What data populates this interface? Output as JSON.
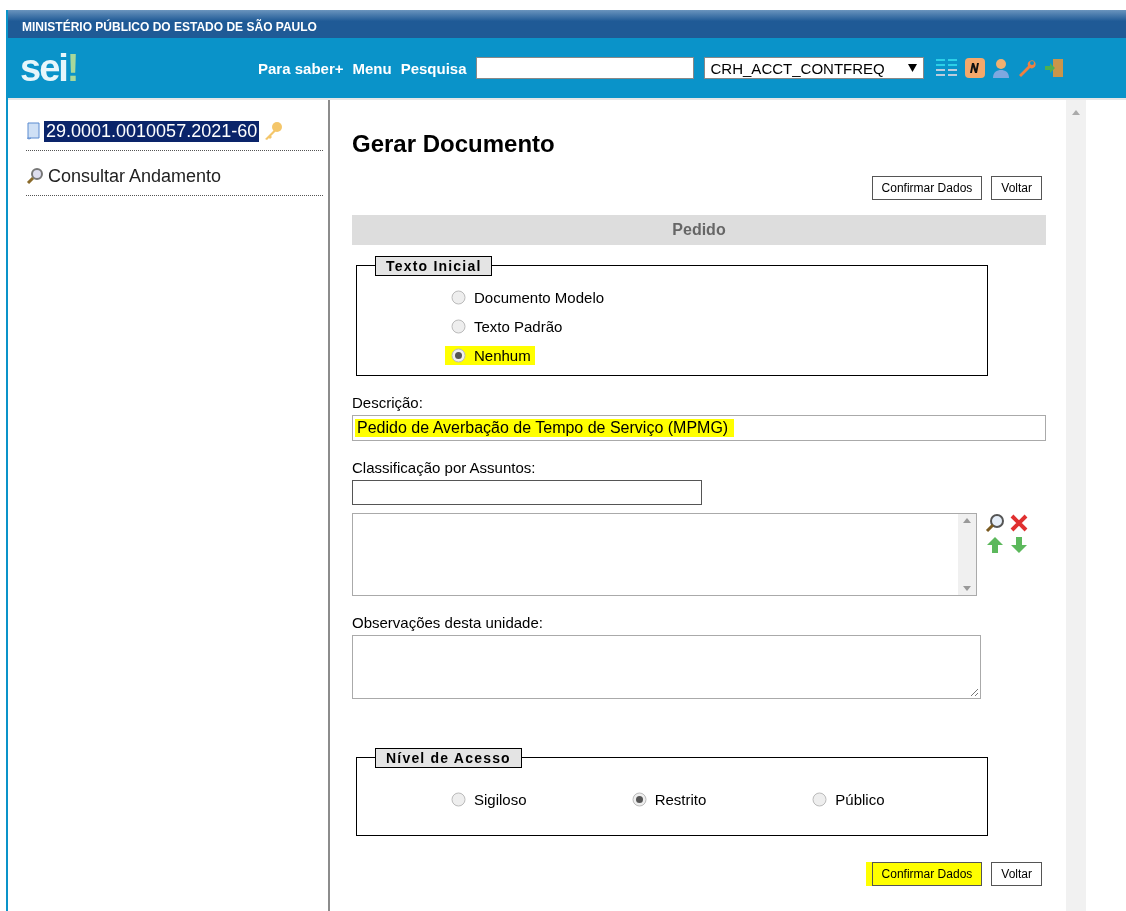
{
  "header": {
    "organization": "MINISTÉRIO PÚBLICO DO ESTADO DE SÃO PAULO",
    "logo": {
      "text": "sei",
      "mark": "!"
    },
    "nav_links": [
      "Para saber+",
      "Menu",
      "Pesquisa"
    ],
    "unit_select": "CRH_ACCT_CONTFREQ"
  },
  "sidebar": {
    "process": {
      "number": "29.0001.0010057.2021-60",
      "selected": true
    },
    "items": [
      {
        "label": "Consultar Andamento"
      }
    ]
  },
  "main": {
    "title": "Gerar Documento",
    "top_buttons": [
      {
        "label": "Confirmar Dados",
        "highlighted": false
      },
      {
        "label": "Voltar",
        "highlighted": false
      }
    ],
    "section": "Pedido",
    "texto_inicial": {
      "legend": "Texto Inicial",
      "options": [
        {
          "label": "Documento Modelo",
          "selected": false,
          "highlighted": false
        },
        {
          "label": "Texto Padrão",
          "selected": false,
          "highlighted": false
        },
        {
          "label": "Nenhum",
          "selected": true,
          "highlighted": true
        }
      ]
    },
    "descricao": {
      "label": "Descrição:",
      "value": "Pedido de Averbação de Tempo de Serviço (MPMG)",
      "highlighted": true
    },
    "classificacao": {
      "label": "Classificação por Assuntos:"
    },
    "observacoes": {
      "label": "Observações desta unidade:"
    },
    "nivel_acesso": {
      "legend": "Nível de Acesso",
      "options": [
        {
          "label": "Sigiloso",
          "selected": false
        },
        {
          "label": "Restrito",
          "selected": true
        },
        {
          "label": "Público",
          "selected": false
        }
      ]
    },
    "bottom_buttons": [
      {
        "label": "Confirmar Dados",
        "highlighted": true
      },
      {
        "label": "Voltar",
        "highlighted": false
      }
    ]
  }
}
